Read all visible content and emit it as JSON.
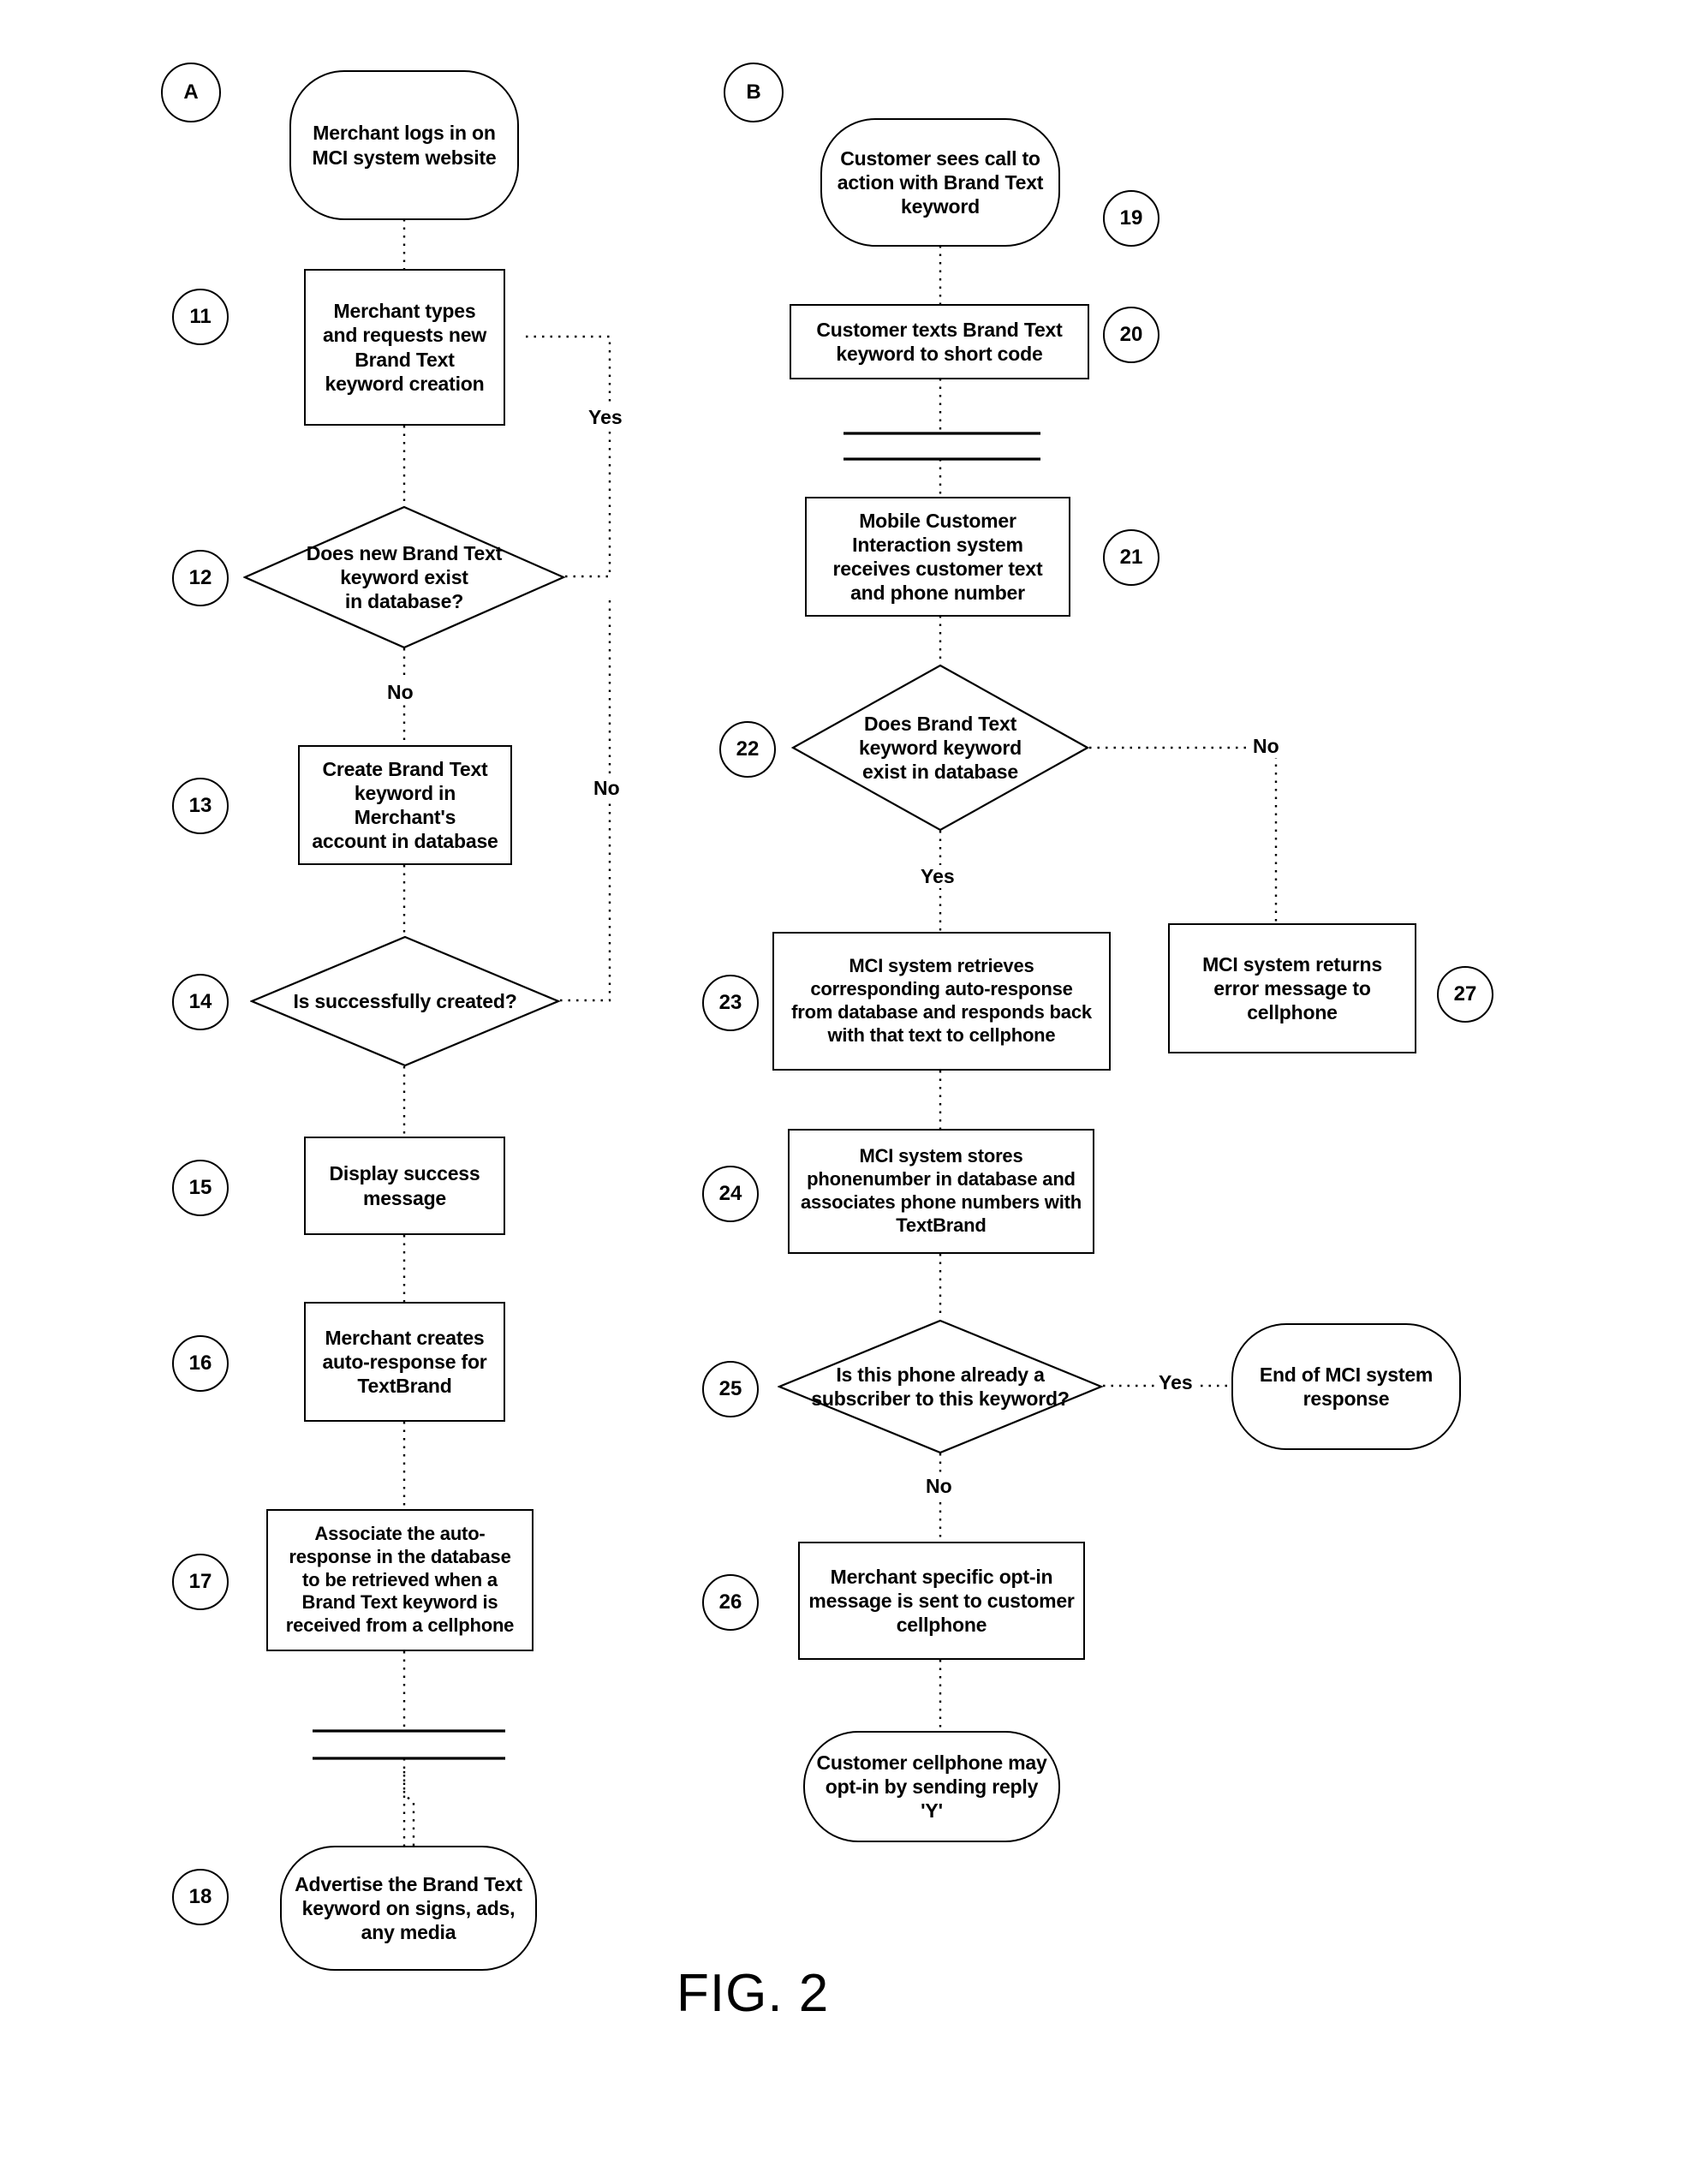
{
  "figure": {
    "caption": "FIG. 2"
  },
  "connectors": {
    "A": "A",
    "B": "B"
  },
  "left_flow": {
    "nodes": [
      {
        "ref": "",
        "shape": "terminal",
        "text": "Merchant logs in on\nMCI system website"
      },
      {
        "ref": "11",
        "shape": "process",
        "text": "Merchant types\nand requests new\nBrand Text\nkeyword creation"
      },
      {
        "ref": "12",
        "shape": "decision",
        "text": "Does new Brand Text\nkeyword exist\nin database?"
      },
      {
        "ref": "13",
        "shape": "process",
        "text": "Create Brand Text\nkeyword in Merchant's\naccount in database"
      },
      {
        "ref": "14",
        "shape": "decision",
        "text": "Is successfully created?"
      },
      {
        "ref": "15",
        "shape": "process",
        "text": "Display success\nmessage"
      },
      {
        "ref": "16",
        "shape": "process",
        "text": "Merchant creates\nauto-response for\nTextBrand"
      },
      {
        "ref": "17",
        "shape": "process",
        "text": "Associate the auto-\nresponse in the database\nto be retrieved when a\nBrand Text keyword  is\nreceived from a cellphone"
      },
      {
        "ref": "18",
        "shape": "terminal",
        "text": "Advertise the Brand Text\nkeyword  on signs, ads,\nany media"
      }
    ],
    "edge_labels": {
      "yes_from_12": "Yes",
      "no_from_12": "No",
      "no_from_14": "No"
    }
  },
  "right_flow": {
    "nodes": [
      {
        "ref": "19",
        "shape": "terminal",
        "text": "Customer sees call to\naction with Brand Text\nkeyword"
      },
      {
        "ref": "20",
        "shape": "process",
        "text": "Customer texts Brand Text\nkeyword to short code"
      },
      {
        "ref": "21",
        "shape": "process",
        "text": "Mobile Customer\nInteraction system\nreceives customer text\nand phone number"
      },
      {
        "ref": "22",
        "shape": "decision",
        "text": "Does Brand Text\nkeyword keyword\nexist in database"
      },
      {
        "ref": "23",
        "shape": "process",
        "text": "MCI system retrieves\ncorresponding auto-response\nfrom database and responds back\nwith that text to cellphone"
      },
      {
        "ref": "27",
        "shape": "process",
        "text": "MCI system returns\nerror message to\ncellphone"
      },
      {
        "ref": "24",
        "shape": "process",
        "text": "MCI system stores\nphonenumber in database and\nassociates phone numbers with\nTextBrand"
      },
      {
        "ref": "25",
        "shape": "decision",
        "text": "Is this phone already a\nsubscriber to this keyword?"
      },
      {
        "ref": "",
        "shape": "terminal",
        "text": "End of MCI system\nresponse"
      },
      {
        "ref": "26",
        "shape": "process",
        "text": "Merchant specific opt-in\nmessage is sent to customer\ncellphone"
      },
      {
        "ref": "",
        "shape": "terminal",
        "text": "Customer cellphone may\nopt-in by sending reply 'Y'"
      }
    ],
    "edge_labels": {
      "no_from_22": "No",
      "yes_from_22": "Yes",
      "yes_from_25": "Yes",
      "no_from_25": "No"
    }
  }
}
